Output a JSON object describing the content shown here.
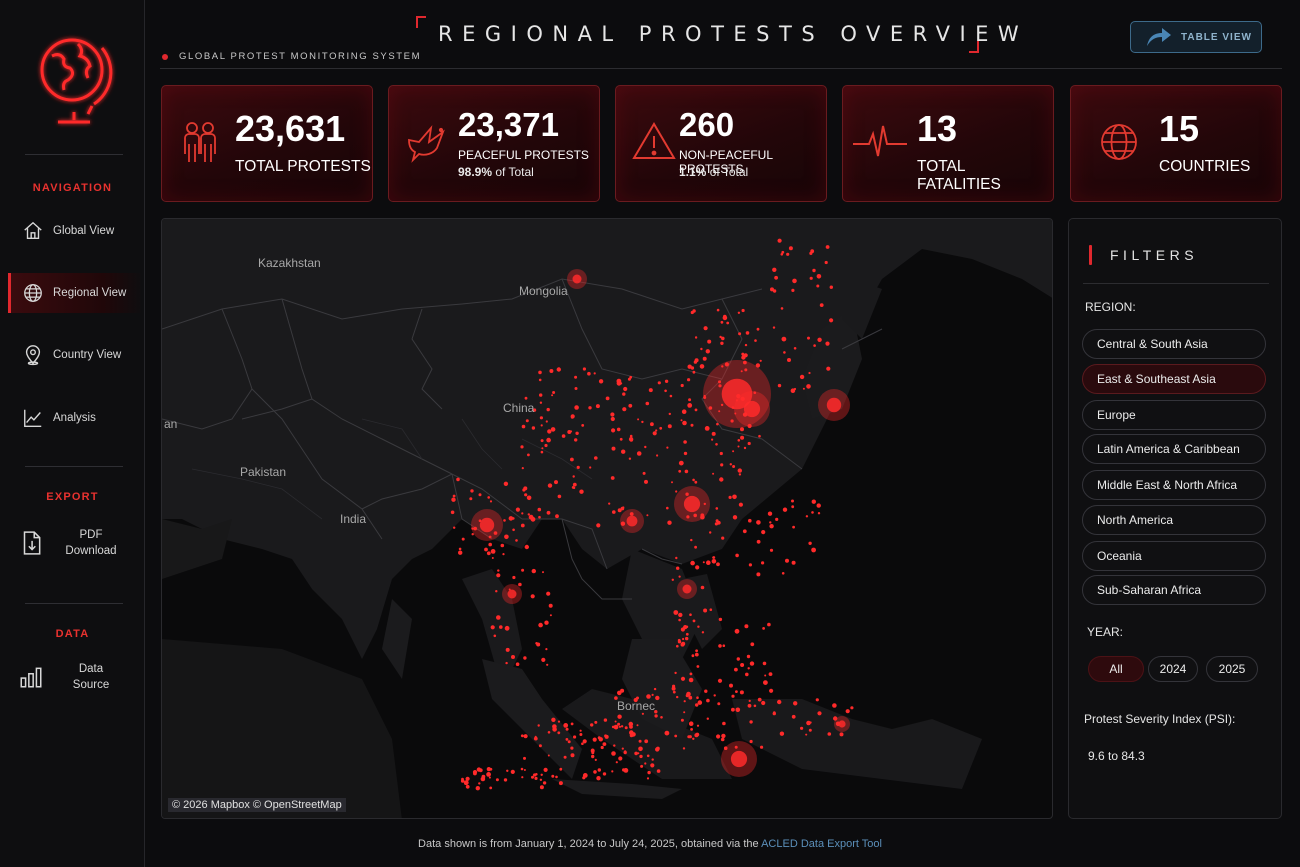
{
  "header": {
    "title": "REGIONAL PROTESTS OVERVIEW",
    "subtitle": "GLOBAL PROTEST MONITORING SYSTEM",
    "table_view_button": "TABLE VIEW"
  },
  "sidebar": {
    "logo_icon": "globe-stand-icon",
    "navigation_heading": "NAVIGATION",
    "nav_items": [
      {
        "label": "Global View",
        "icon": "home-icon",
        "active": false
      },
      {
        "label": "Regional View",
        "icon": "globe-icon",
        "active": true
      },
      {
        "label": "Country View",
        "icon": "map-pin-icon",
        "active": false
      },
      {
        "label": "Analysis",
        "icon": "line-chart-icon",
        "active": false
      }
    ],
    "export_heading": "EXPORT",
    "pdf_line1": "PDF",
    "pdf_line2": "Download",
    "data_heading": "DATA",
    "data_line1": "Data",
    "data_line2": "Source"
  },
  "kpis": {
    "total_protests": {
      "value": "23,631",
      "label": "TOTAL PROTESTS",
      "icon": "people-icon"
    },
    "peaceful": {
      "value": "23,371",
      "label": "PEACEFUL PROTESTS",
      "pct": "98.9%",
      "pct_suffix": "of Total",
      "icon": "dove-icon"
    },
    "non_peaceful": {
      "value": "260",
      "label": "NON-PEACEFUL PROTESTS",
      "pct": "1.1%",
      "pct_suffix": "of Total",
      "icon": "warning-icon"
    },
    "fatalities": {
      "value": "13",
      "label": "TOTAL FATALITIES",
      "icon": "heartbeat-icon"
    },
    "countries": {
      "value": "15",
      "label": "COUNTRIES",
      "icon": "globe-icon"
    }
  },
  "map": {
    "labels": {
      "kazakhstan": "Kazakhstan",
      "mongolia": "Mongolia",
      "china": "China",
      "pakistan": "Pakistan",
      "india": "India",
      "an": "an",
      "borneo": "Bornec"
    },
    "attribution": "© 2026 Mapbox © OpenStreetMap",
    "point_color": "#ff2a2a"
  },
  "filters": {
    "title": "FILTERS",
    "region_label": "REGION:",
    "regions": [
      {
        "label": "Central & South Asia",
        "active": false
      },
      {
        "label": "East & Southeast Asia",
        "active": true
      },
      {
        "label": "Europe",
        "active": false
      },
      {
        "label": "Latin America & Caribbean",
        "active": false
      },
      {
        "label": "Middle East & North Africa",
        "active": false
      },
      {
        "label": "North America",
        "active": false
      },
      {
        "label": "Oceania",
        "active": false
      },
      {
        "label": "Sub-Saharan Africa",
        "active": false
      }
    ],
    "year_label": "YEAR:",
    "years": [
      {
        "label": "All",
        "active": true
      },
      {
        "label": "2024",
        "active": false
      },
      {
        "label": "2025",
        "active": false
      }
    ],
    "psi_label": "Protest Severity Index (PSI):",
    "psi_range": "9.6 to 84.3"
  },
  "footer": {
    "text": "Data shown is from January 1, 2024 to July 24, 2025, obtained via the",
    "link": "ACLED Data Export Tool"
  },
  "colors": {
    "accent": "#e0282e",
    "background": "#0c0c0e",
    "card": "#230609",
    "link": "#5b8fb9"
  }
}
